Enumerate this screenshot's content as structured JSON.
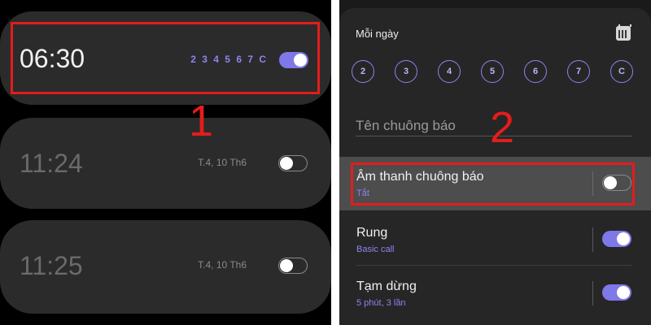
{
  "left_panel": {
    "alarms": [
      {
        "time": "06:30",
        "repeat_days": "2 3 4 5 6 7 C",
        "enabled": true
      },
      {
        "time": "11:24",
        "date": "T.4, 10 Th6",
        "enabled": false
      },
      {
        "time": "11:25",
        "date": "T.4, 10 Th6",
        "enabled": false
      }
    ],
    "marker": "1"
  },
  "right_panel": {
    "repeat_label": "Mỗi ngày",
    "days": [
      "2",
      "3",
      "4",
      "5",
      "6",
      "7",
      "C"
    ],
    "name_placeholder": "Tên chuông báo",
    "marker": "2",
    "rows": {
      "sound": {
        "title": "Âm thanh chuông báo",
        "sub": "Tắt",
        "enabled": false
      },
      "vibrate": {
        "title": "Rung",
        "sub": "Basic call",
        "enabled": true
      },
      "snooze": {
        "title": "Tạm dừng",
        "sub": "5 phút, 3 lần",
        "enabled": true
      }
    }
  },
  "colors": {
    "accent": "#8b84f0",
    "toggle_on": "#7f78e8",
    "highlight": "#e41c1c",
    "card_bg": "#2b2b2b"
  },
  "icons": {
    "calendar": "calendar-icon"
  }
}
